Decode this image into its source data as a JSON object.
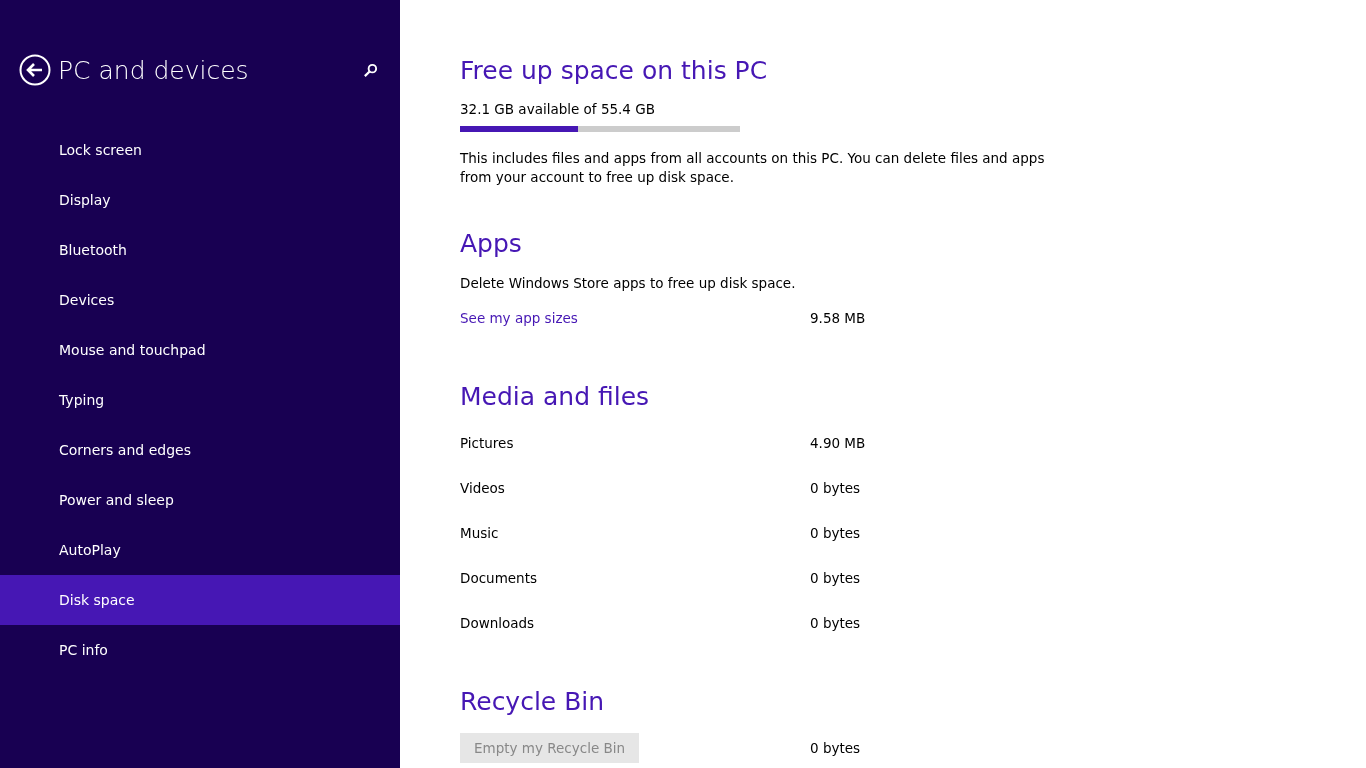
{
  "sidebar": {
    "title": "PC and devices",
    "items": [
      {
        "label": "Lock screen",
        "selected": false
      },
      {
        "label": "Display",
        "selected": false
      },
      {
        "label": "Bluetooth",
        "selected": false
      },
      {
        "label": "Devices",
        "selected": false
      },
      {
        "label": "Mouse and touchpad",
        "selected": false
      },
      {
        "label": "Typing",
        "selected": false
      },
      {
        "label": "Corners and edges",
        "selected": false
      },
      {
        "label": "Power and sleep",
        "selected": false
      },
      {
        "label": "AutoPlay",
        "selected": false
      },
      {
        "label": "Disk space",
        "selected": true
      },
      {
        "label": "PC info",
        "selected": false
      }
    ]
  },
  "main": {
    "title": "Free up space on this PC",
    "storage": {
      "label": "32.1 GB available of 55.4 GB",
      "level": 0.42
    },
    "description": "This includes files and apps from all accounts on this PC. You can delete files and apps from your account to free up disk space.",
    "sections": [
      {
        "heading": "Apps",
        "description": "Delete Windows Store apps to free up disk space.",
        "rows": [
          {
            "kind": "link",
            "label": "See my app sizes",
            "value": "9.58 MB"
          }
        ]
      },
      {
        "heading": "Media and files",
        "rows": [
          {
            "kind": "text",
            "label": "Pictures",
            "value": "4.90 MB"
          },
          {
            "kind": "text",
            "label": "Videos",
            "value": "0 bytes"
          },
          {
            "kind": "text",
            "label": "Music",
            "value": "0 bytes"
          },
          {
            "kind": "text",
            "label": "Documents",
            "value": "0 bytes"
          },
          {
            "kind": "text",
            "label": "Downloads",
            "value": "0 bytes"
          }
        ]
      },
      {
        "heading": "Recycle Bin",
        "rows": [
          {
            "kind": "button",
            "label": "Empty my Recycle Bin",
            "disabled": true,
            "value": "0 bytes"
          }
        ]
      }
    ]
  }
}
